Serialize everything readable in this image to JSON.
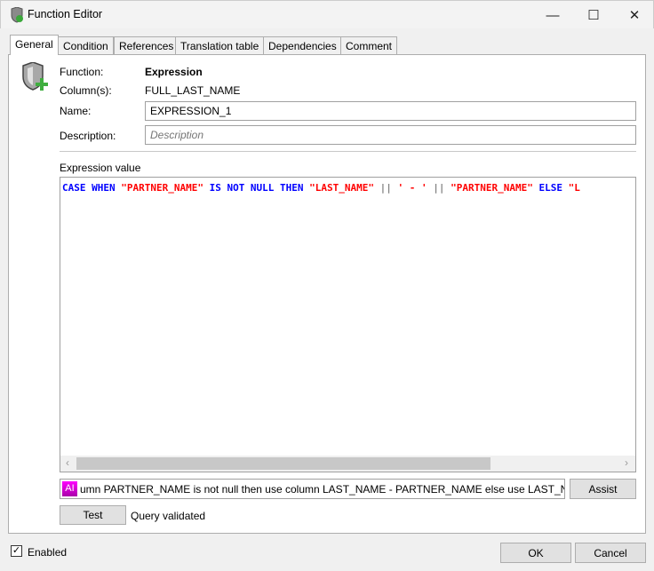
{
  "window": {
    "title": "Function Editor",
    "minimize": "—",
    "maximize": "☐",
    "close": "✕"
  },
  "tabs": [
    {
      "label": "General"
    },
    {
      "label": "Condition"
    },
    {
      "label": "References"
    },
    {
      "label": "Translation table"
    },
    {
      "label": "Dependencies"
    },
    {
      "label": "Comment"
    }
  ],
  "general": {
    "function_label": "Function:",
    "function_value": "Expression",
    "columns_label": "Column(s):",
    "columns_value": "FULL_LAST_NAME",
    "name_label": "Name:",
    "name_value": "EXPRESSION_1",
    "description_label": "Description:",
    "description_placeholder": "Description",
    "expression_label": "Expression value",
    "expression_tokens": [
      {
        "t": "CASE WHEN ",
        "c": "kw"
      },
      {
        "t": "\"PARTNER_NAME\"",
        "c": "st"
      },
      {
        "t": " IS NOT NULL THEN ",
        "c": "kw"
      },
      {
        "t": "\"LAST_NAME\"",
        "c": "st"
      },
      {
        "t": " || ",
        "c": "op"
      },
      {
        "t": "' - '",
        "c": "st"
      },
      {
        "t": " || ",
        "c": "op"
      },
      {
        "t": "\"PARTNER_NAME\"",
        "c": "st"
      },
      {
        "t": " ELSE ",
        "c": "kw"
      },
      {
        "t": "\"L",
        "c": "st"
      }
    ],
    "ai_prompt": "umn PARTNER_NAME is not null then use column LAST_NAME - PARTNER_NAME else use LAST_NAME",
    "ai_icon": "AI",
    "assist_label": "Assist",
    "test_label": "Test",
    "status": "Query validated"
  },
  "footer": {
    "enabled_label": "Enabled",
    "enabled": true,
    "ok_label": "OK",
    "cancel_label": "Cancel"
  }
}
